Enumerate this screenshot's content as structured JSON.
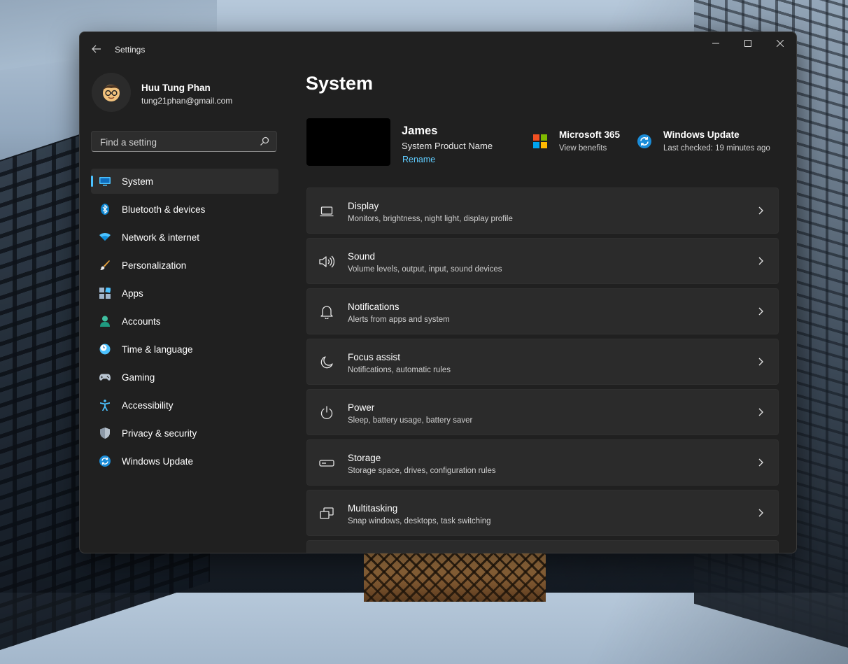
{
  "window": {
    "title": "Settings"
  },
  "profile": {
    "name": "Huu Tung Phan",
    "email": "tung21phan@gmail.com"
  },
  "search": {
    "placeholder": "Find a setting"
  },
  "sidebar": {
    "items": [
      {
        "label": "System",
        "icon": "system-icon",
        "selected": true
      },
      {
        "label": "Bluetooth & devices",
        "icon": "bluetooth-icon"
      },
      {
        "label": "Network & internet",
        "icon": "wifi-icon"
      },
      {
        "label": "Personalization",
        "icon": "brush-icon"
      },
      {
        "label": "Apps",
        "icon": "apps-icon"
      },
      {
        "label": "Accounts",
        "icon": "person-icon"
      },
      {
        "label": "Time & language",
        "icon": "clock-globe-icon"
      },
      {
        "label": "Gaming",
        "icon": "gamepad-icon"
      },
      {
        "label": "Accessibility",
        "icon": "accessibility-icon"
      },
      {
        "label": "Privacy & security",
        "icon": "shield-icon"
      },
      {
        "label": "Windows Update",
        "icon": "sync-icon"
      }
    ]
  },
  "main": {
    "title": "System",
    "device": {
      "name": "James",
      "model": "System Product Name",
      "rename": "Rename"
    },
    "ms365": {
      "title": "Microsoft 365",
      "subtitle": "View benefits"
    },
    "windows_update": {
      "title": "Windows Update",
      "subtitle": "Last checked: 19 minutes ago"
    },
    "cards": [
      {
        "title": "Display",
        "subtitle": "Monitors, brightness, night light, display profile",
        "icon": "monitor-icon"
      },
      {
        "title": "Sound",
        "subtitle": "Volume levels, output, input, sound devices",
        "icon": "speaker-icon"
      },
      {
        "title": "Notifications",
        "subtitle": "Alerts from apps and system",
        "icon": "bell-icon"
      },
      {
        "title": "Focus assist",
        "subtitle": "Notifications, automatic rules",
        "icon": "moon-icon"
      },
      {
        "title": "Power",
        "subtitle": "Sleep, battery usage, battery saver",
        "icon": "power-icon"
      },
      {
        "title": "Storage",
        "subtitle": "Storage space, drives, configuration rules",
        "icon": "drive-icon"
      },
      {
        "title": "Multitasking",
        "subtitle": "Snap windows, desktops, task switching",
        "icon": "multitask-icon"
      }
    ]
  },
  "colors": {
    "accent": "#4cc2ff",
    "link": "#60cdff",
    "window_bg": "#202020",
    "card_bg": "#2b2b2b"
  }
}
